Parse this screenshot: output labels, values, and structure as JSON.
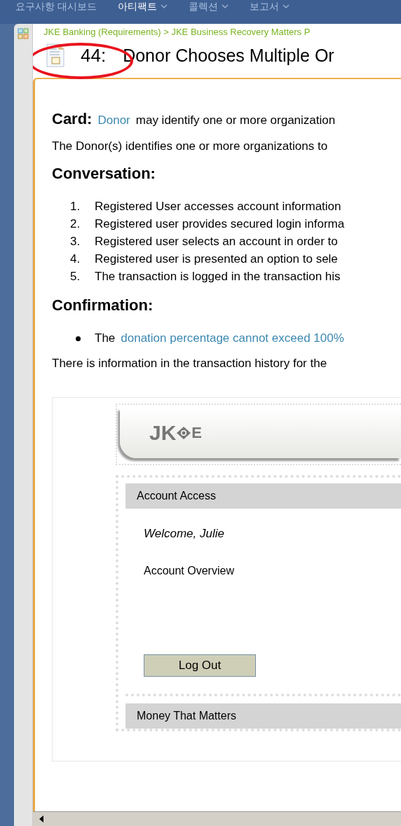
{
  "nav": [
    {
      "label": "요구사항 대시보드",
      "selected": false,
      "has_menu": false
    },
    {
      "label": "아티팩트",
      "selected": true,
      "has_menu": true
    },
    {
      "label": "콜렉션",
      "selected": false,
      "has_menu": true
    },
    {
      "label": "보고서",
      "selected": false,
      "has_menu": true
    }
  ],
  "breadcrumb": "JKE Banking (Requirements) > JKE Business Recovery Matters P",
  "artifact": {
    "id": "44:",
    "title": "Donor Chooses Multiple Or"
  },
  "card": {
    "heading": "Card:",
    "link": "Donor",
    "text": "may identify one or more organization"
  },
  "description": "The Donor(s) identifies one or more organizations to",
  "conversation": {
    "heading": "Conversation:",
    "steps": [
      {
        "number": "1.",
        "text": "Registered User accesses account information"
      },
      {
        "number": "2.",
        "text": "Registered user provides secured login informa"
      },
      {
        "number": "3.",
        "text": "Registered user selects an account in order to"
      },
      {
        "number": "4.",
        "text": "Registered user is presented an option to sele"
      },
      {
        "number": "5.",
        "text": "The transaction is logged in the transaction his"
      }
    ]
  },
  "confirmation": {
    "heading": "Confirmation:",
    "bullets": [
      {
        "text": "The",
        "link": "donation percentage cannot exceed 100%"
      }
    ],
    "note": "There is information in the transaction history for the"
  },
  "mockup": {
    "logo": {
      "left": "JK",
      "right": "E"
    },
    "sections": [
      {
        "header": "Account Access",
        "greeting": "Welcome, Julie",
        "link": "Account Overview",
        "button": "Log Out"
      },
      {
        "header": "Money That Matters"
      }
    ]
  }
}
